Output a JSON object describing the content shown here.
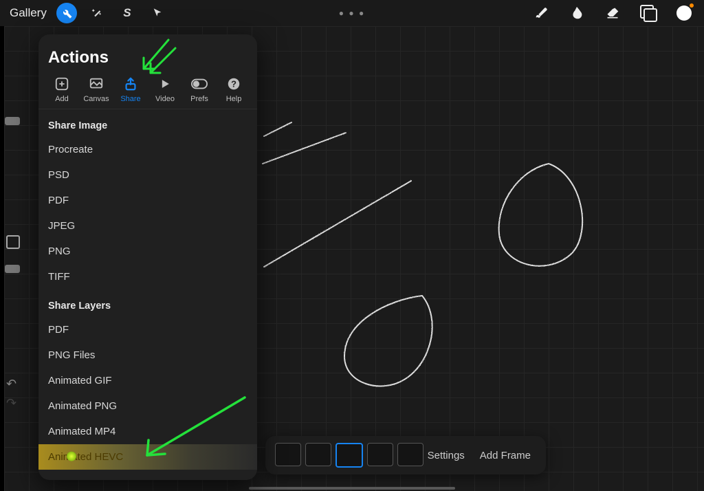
{
  "toolbar": {
    "gallery": "Gallery"
  },
  "actions": {
    "title": "Actions",
    "tabs": {
      "add": "Add",
      "canvas": "Canvas",
      "share": "Share",
      "video": "Video",
      "prefs": "Prefs",
      "help": "Help"
    },
    "share_image_head": "Share Image",
    "share_image_opts": [
      "Procreate",
      "PSD",
      "PDF",
      "JPEG",
      "PNG",
      "TIFF"
    ],
    "share_layers_head": "Share Layers",
    "share_layers_opts": [
      "PDF",
      "PNG Files",
      "Animated GIF",
      "Animated PNG",
      "Animated MP4",
      "Animated HEVC"
    ]
  },
  "timeline": {
    "settings": "Settings",
    "add_frame": "Add Frame"
  }
}
